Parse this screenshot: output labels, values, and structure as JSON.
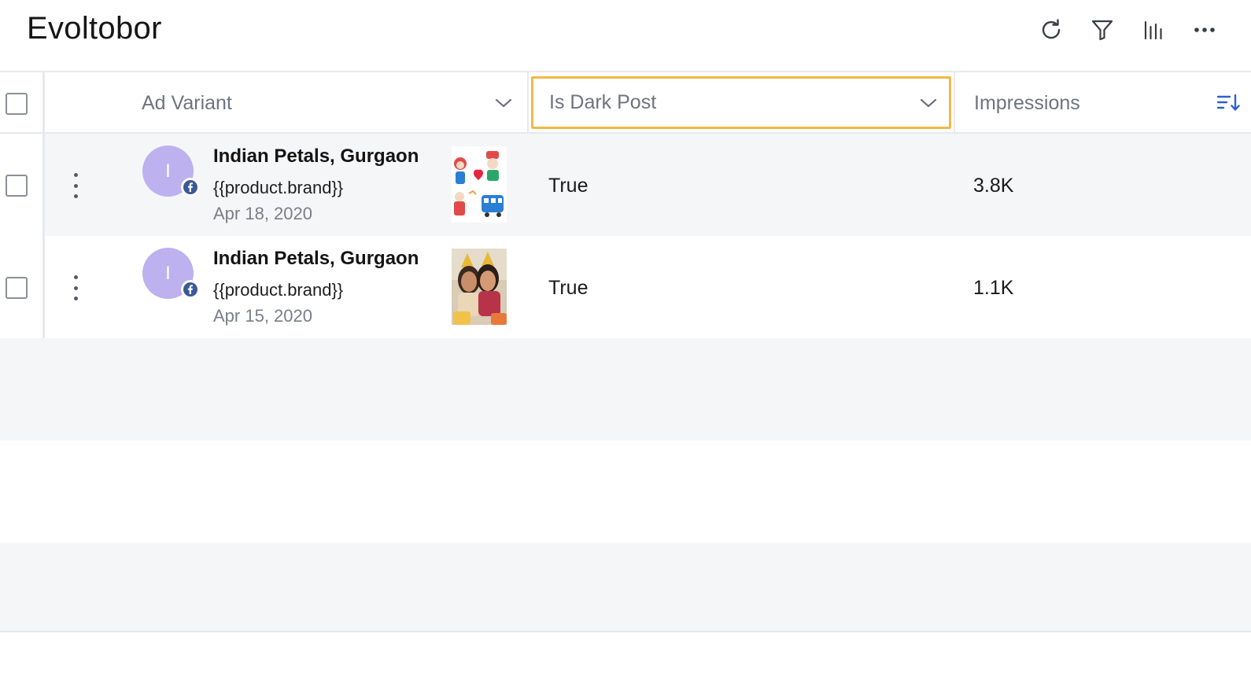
{
  "header": {
    "title": "Evoltobor",
    "tools": {
      "refresh_icon": "refresh-icon",
      "filter_icon": "filter-icon",
      "columns_icon": "bar-chart-icon",
      "more_icon": "more-horizontal-icon"
    }
  },
  "table": {
    "columns": {
      "ad_variant": "Ad Variant",
      "is_dark_post": "Is Dark Post",
      "impressions": "Impressions"
    },
    "rows": [
      {
        "avatar_initial": "I",
        "name": "Indian Petals, Gurgaon",
        "brand": "{{product.brand}}",
        "date": "Apr 18, 2020",
        "is_dark_post": "True",
        "impressions": "3.8K"
      },
      {
        "avatar_initial": "I",
        "name": "Indian Petals, Gurgaon",
        "brand": "{{product.brand}}",
        "date": "Apr 15, 2020",
        "is_dark_post": "True",
        "impressions": "1.1K"
      }
    ]
  },
  "colors": {
    "highlight_border": "#f3b848",
    "avatar_bg": "#bdb1f0",
    "sort_icon": "#2f5fd0",
    "facebook": "#3b5998",
    "stripe": "#f5f6f8"
  }
}
